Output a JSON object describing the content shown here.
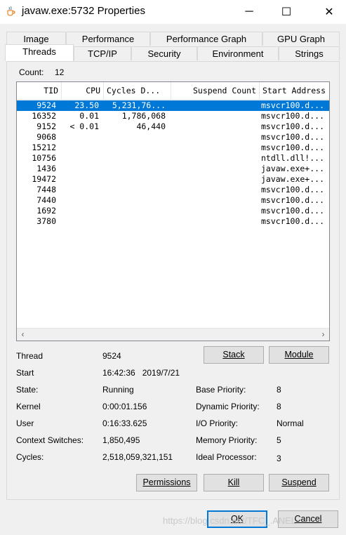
{
  "window": {
    "title": "javaw.exe:5732 Properties",
    "minimize_glyph": "─",
    "maximize_glyph": "☐",
    "close_glyph": "✕",
    "icon": "java-cup-icon"
  },
  "tabs_row1": [
    "Image",
    "Performance",
    "Performance Graph",
    "GPU Graph"
  ],
  "tabs_row2": [
    "Threads",
    "TCP/IP",
    "Security",
    "Environment",
    "Strings"
  ],
  "active_tab": "Threads",
  "count": {
    "label": "Count:",
    "value": "12"
  },
  "thread_list": {
    "columns": [
      "TID",
      "CPU",
      "Cycles D...",
      "Suspend Count",
      "Start Address"
    ],
    "rows": [
      {
        "tid": "9524",
        "cpu": "23.50",
        "cycles": "5,231,76...",
        "suspend": "",
        "address": "msvcr100.d..."
      },
      {
        "tid": "16352",
        "cpu": "0.01",
        "cycles": "1,786,068",
        "suspend": "",
        "address": "msvcr100.d..."
      },
      {
        "tid": "9152",
        "cpu": "< 0.01",
        "cycles": "46,440",
        "suspend": "",
        "address": "msvcr100.d..."
      },
      {
        "tid": "9068",
        "cpu": "",
        "cycles": "",
        "suspend": "",
        "address": "msvcr100.d..."
      },
      {
        "tid": "15212",
        "cpu": "",
        "cycles": "",
        "suspend": "",
        "address": "msvcr100.d..."
      },
      {
        "tid": "10756",
        "cpu": "",
        "cycles": "",
        "suspend": "",
        "address": "ntdll.dll!..."
      },
      {
        "tid": "1436",
        "cpu": "",
        "cycles": "",
        "suspend": "",
        "address": "javaw.exe+..."
      },
      {
        "tid": "19472",
        "cpu": "",
        "cycles": "",
        "suspend": "",
        "address": "javaw.exe+..."
      },
      {
        "tid": "7448",
        "cpu": "",
        "cycles": "",
        "suspend": "",
        "address": "msvcr100.d..."
      },
      {
        "tid": "7440",
        "cpu": "",
        "cycles": "",
        "suspend": "",
        "address": "msvcr100.d..."
      },
      {
        "tid": "1692",
        "cpu": "",
        "cycles": "",
        "suspend": "",
        "address": "msvcr100.d..."
      },
      {
        "tid": "3780",
        "cpu": "",
        "cycles": "",
        "suspend": "",
        "address": "msvcr100.d..."
      }
    ],
    "selected_index": 0
  },
  "details": {
    "thread_label": "Thread",
    "thread_value": "9524",
    "start_label": "Start",
    "start_value": "16:42:36   2019/7/21",
    "state_label": "State:",
    "state_value": "Running",
    "kernel_label": "Kernel",
    "kernel_value": "0:00:01.156",
    "user_label": "User",
    "user_value": "0:16:33.625",
    "ctx_label": "Context Switches:",
    "ctx_value": "1,850,495",
    "cycles_label": "Cycles:",
    "cycles_value": "2,518,059,321,151",
    "base_prio_label": "Base Priority:",
    "base_prio_value": "8",
    "dyn_prio_label": "Dynamic Priority:",
    "dyn_prio_value": "8",
    "io_prio_label": "I/O Priority:",
    "io_prio_value": "Normal",
    "mem_prio_label": "Memory Priority:",
    "mem_prio_value": "5",
    "ideal_proc_label": "Ideal Processor:",
    "ideal_proc_value": "3"
  },
  "buttons": {
    "stack": "Stack",
    "module": "Module",
    "permissions": "Permissions",
    "kill": "Kill",
    "suspend": "Suspend",
    "ok": "OK",
    "cancel": "Cancel"
  },
  "watermark": "https://blog.csdn.net/TFC_.ANEL",
  "colors": {
    "selection": "#0078d7",
    "default_button_border": "#0078d7"
  }
}
